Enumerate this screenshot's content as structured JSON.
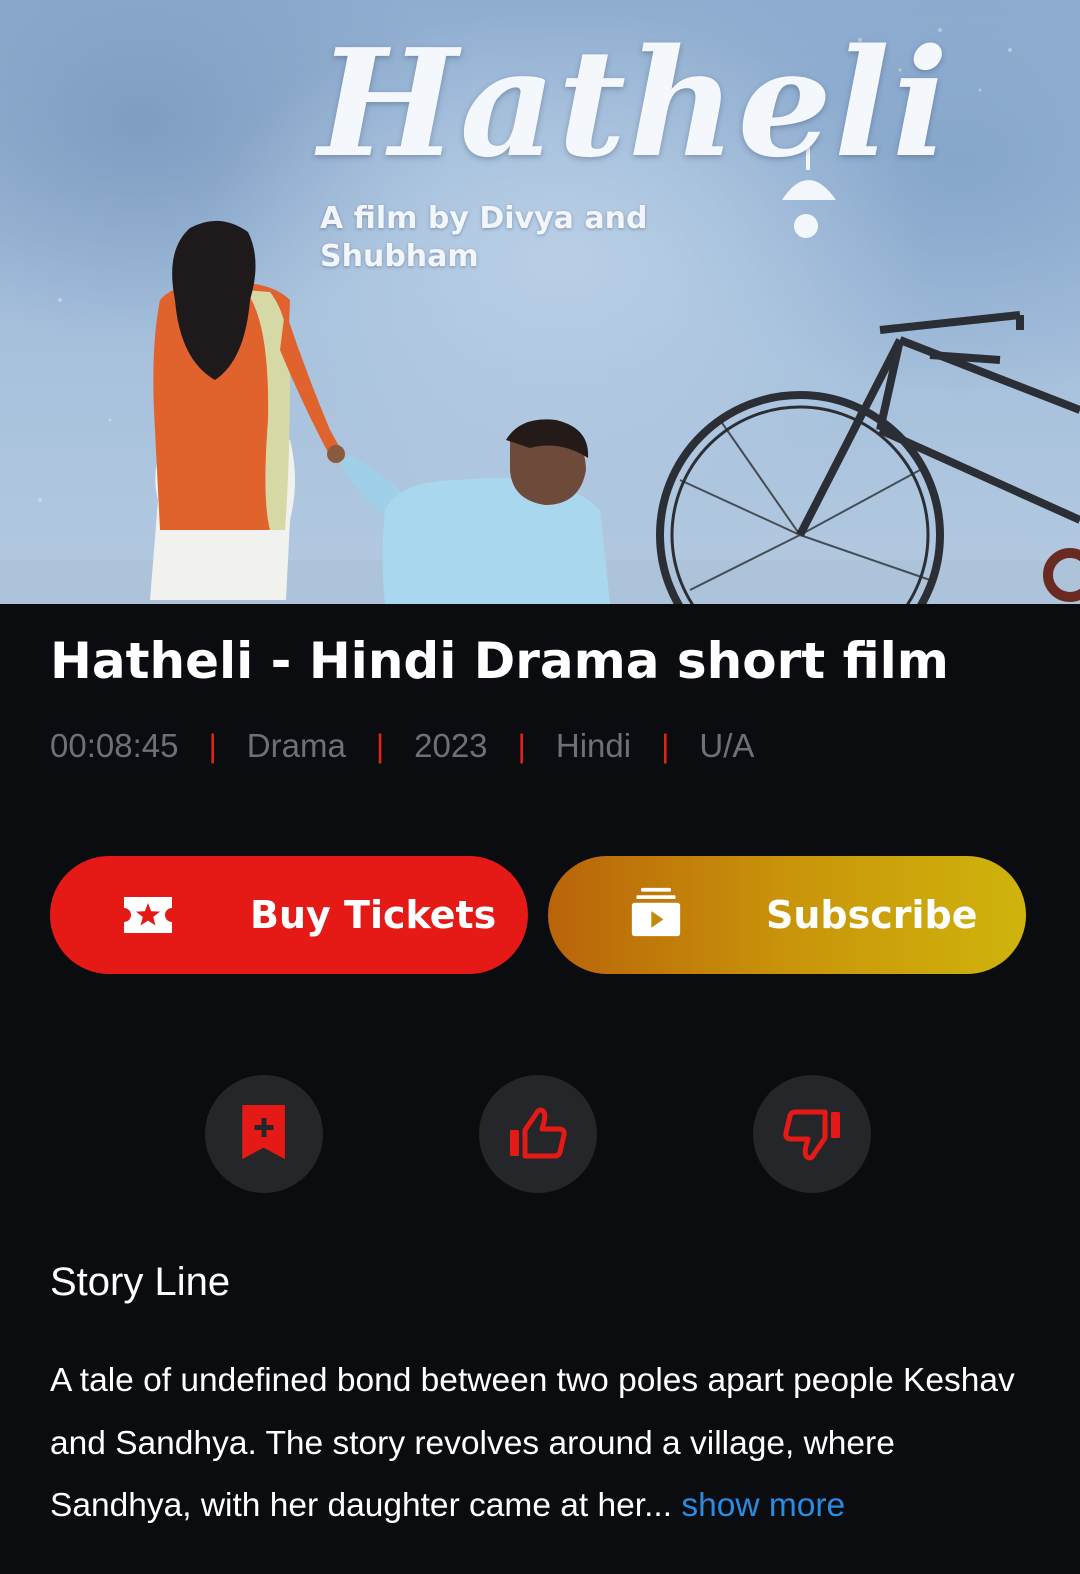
{
  "poster": {
    "title_art": "Hatheli",
    "subtitle_art": "A film by Divya and Shubham"
  },
  "film": {
    "title": "Hatheli - Hindi Drama short film",
    "meta": [
      "00:08:45",
      "Drama",
      "2023",
      "Hindi",
      "U/A"
    ],
    "separator": "|"
  },
  "actions": {
    "buy_label": "Buy Tickets",
    "subscribe_label": "Subscribe",
    "buy_icon": "ticket-star-icon",
    "subscribe_icon": "subscription-play-icon"
  },
  "quick_actions": [
    {
      "icon": "bookmark-add-icon"
    },
    {
      "icon": "thumbs-up-icon"
    },
    {
      "icon": "thumbs-down-icon"
    }
  ],
  "story": {
    "heading": "Story Line",
    "text": "A tale of undefined bond between two poles apart people Keshav and Sandhya. The story revolves around a village, where Sandhya, with her daughter came at her",
    "ellipsis": "...",
    "show_more": "show more"
  },
  "colors": {
    "background": "#0b0c10",
    "accent_red": "#e51a17",
    "separator_red": "#e0231b",
    "meta_gray": "#6e7077",
    "link_blue": "#2a8be3",
    "subscribe_gradient_start": "#b9640a",
    "subscribe_gradient_end": "#cfb40c",
    "round_button_bg": "#252629"
  }
}
